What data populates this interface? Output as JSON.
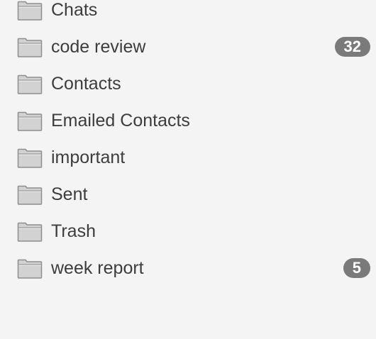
{
  "folders": [
    {
      "label": "Chats",
      "icon": "folder-icon",
      "count": ""
    },
    {
      "label": "code review",
      "icon": "folder-icon",
      "count": "32"
    },
    {
      "label": "Contacts",
      "icon": "folder-icon",
      "count": ""
    },
    {
      "label": "Emailed Contacts",
      "icon": "folder-icon",
      "count": ""
    },
    {
      "label": "important",
      "icon": "folder-icon",
      "count": ""
    },
    {
      "label": "Sent",
      "icon": "folder-icon",
      "count": ""
    },
    {
      "label": "Trash",
      "icon": "folder-icon",
      "count": ""
    },
    {
      "label": "week report",
      "icon": "folder-icon",
      "count": "5"
    }
  ],
  "colors": {
    "background": "#f4f4f4",
    "text": "#3d3d3d",
    "badge": "#7a7a7a",
    "folder_fill": "#d2d2d2",
    "folder_stroke": "#8e8e8e"
  }
}
